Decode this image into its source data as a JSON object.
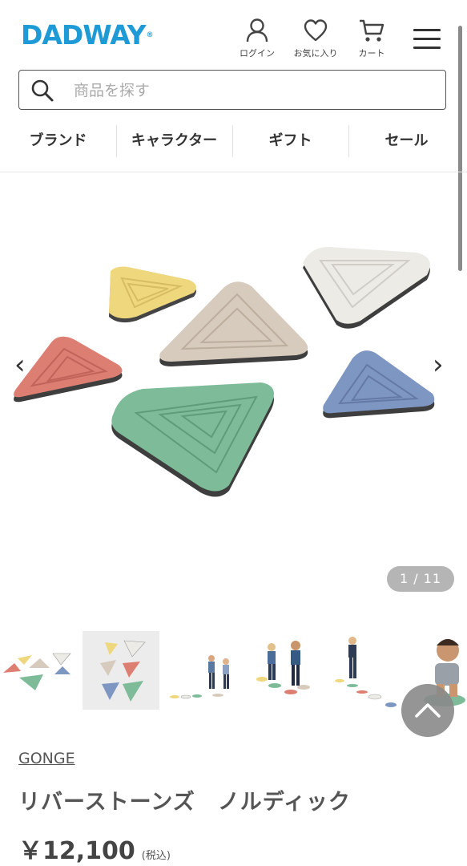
{
  "header": {
    "logo": "DADWAY",
    "logo_mark": "®",
    "login_label": "ログイン",
    "favorites_label": "お気に入り",
    "cart_label": "カート"
  },
  "search": {
    "placeholder": "商品を探す"
  },
  "nav": [
    {
      "label": "ブランド"
    },
    {
      "label": "キャラクター"
    },
    {
      "label": "ギフト"
    },
    {
      "label": "セール"
    }
  ],
  "gallery": {
    "counter": "1 / 11"
  },
  "product": {
    "brand": "GONGE",
    "name": "リバーストーンズ　ノルディック",
    "price": "￥12,100",
    "tax_note": "(税込)"
  },
  "colors": {
    "logo": "#1e9ad6",
    "stone_yellow": "#efd77e",
    "stone_beige": "#d7cbbd",
    "stone_white": "#ecebe6",
    "stone_red": "#dd7e73",
    "stone_blue": "#7e96c2",
    "stone_green": "#7ebc99"
  }
}
